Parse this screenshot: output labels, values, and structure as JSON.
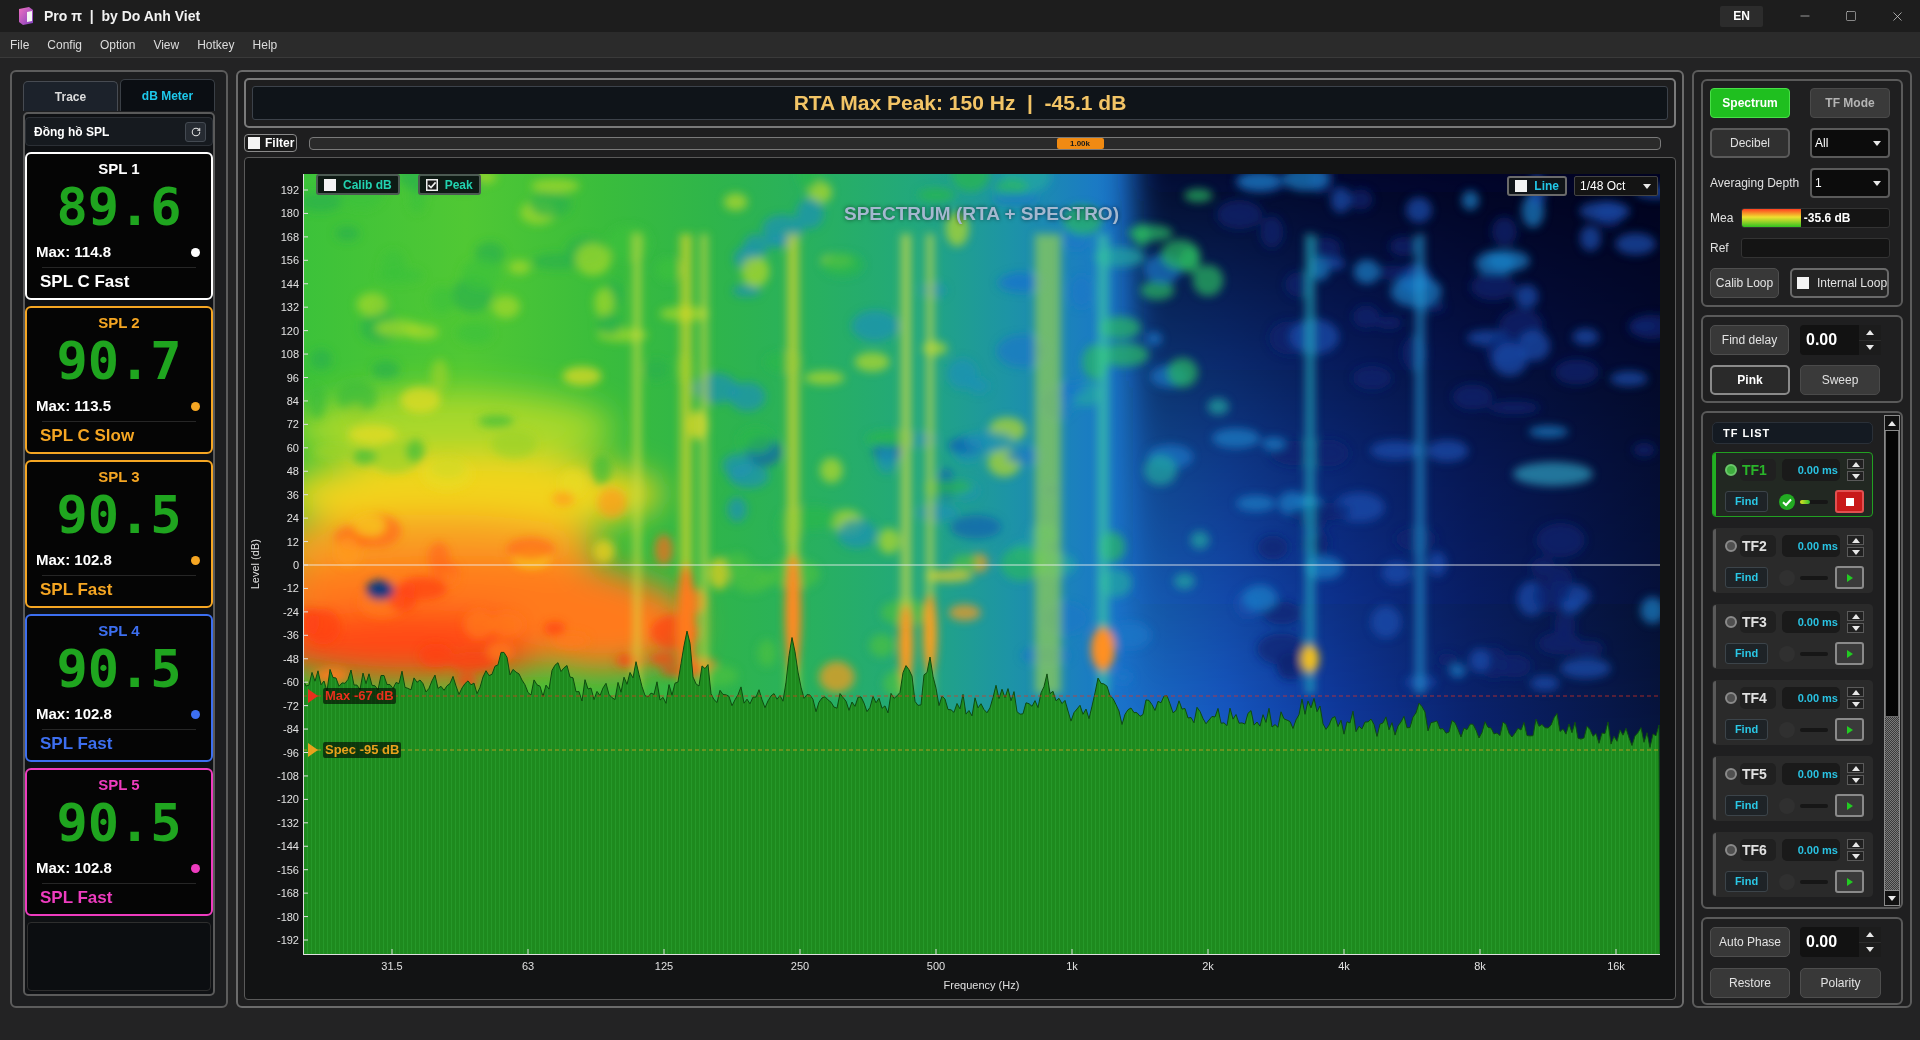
{
  "window": {
    "title": "Pro π  |  by Do Anh Viet",
    "language": "EN"
  },
  "menu": [
    "File",
    "Config",
    "Option",
    "View",
    "Hotkey",
    "Help"
  ],
  "left_panel": {
    "tabs": [
      {
        "label": "Trace",
        "selected": false
      },
      {
        "label": "dB Meter",
        "selected": true
      }
    ],
    "title": "Đồng hồ SPL",
    "meters": [
      {
        "name": "SPL 1",
        "value": "89.6",
        "max": "Max: 114.8",
        "mode": "SPL C Fast",
        "color": "#ffffff"
      },
      {
        "name": "SPL 2",
        "value": "90.7",
        "max": "Max: 113.5",
        "mode": "SPL C Slow",
        "color": "#f5a623"
      },
      {
        "name": "SPL 3",
        "value": "90.5",
        "max": "Max: 102.8",
        "mode": "SPL Fast",
        "color": "#f5a623"
      },
      {
        "name": "SPL 4",
        "value": "90.5",
        "max": "Max: 102.8",
        "mode": "SPL Fast",
        "color": "#3d6ff0"
      },
      {
        "name": "SPL 5",
        "value": "90.5",
        "max": "Max: 102.8",
        "mode": "SPL Fast",
        "color": "#ee3cbf"
      }
    ]
  },
  "readout": "RTA Max Peak: 150 Hz  |  -45.1 dB",
  "filter": {
    "label": "Filter",
    "checked": false,
    "thumb_label": "1.00k",
    "level": 0.57
  },
  "chart": {
    "title": "SPECTRUM (RTA + SPECTRO)",
    "ylabel": "Level (dB)",
    "xlabel": "Frequency (Hz)",
    "yticks": [
      "192",
      "180",
      "168",
      "156",
      "144",
      "132",
      "120",
      "108",
      "96",
      "84",
      "72",
      "60",
      "48",
      "36",
      "24",
      "12",
      "0",
      "-12",
      "-24",
      "-36",
      "-48",
      "-60",
      "-72",
      "-84",
      "-96",
      "-108",
      "-120",
      "-132",
      "-144",
      "-156",
      "-168",
      "-180",
      "-192"
    ],
    "xticks": [
      "31.5",
      "63",
      "125",
      "250",
      "500",
      "1k",
      "2k",
      "4k",
      "8k",
      "16k"
    ],
    "toggles": [
      {
        "label": "Calib dB",
        "checked": false
      },
      {
        "label": "Peak",
        "checked": true
      }
    ],
    "line_toggle": {
      "label": "Line",
      "checked": false
    },
    "resolution": "1/48 Oct",
    "markers": [
      {
        "kind": "max",
        "label": "Max -67 dB",
        "color": "#e8301c"
      },
      {
        "kind": "spec",
        "label": "Spec -95 dB",
        "color": "#e8a21c"
      }
    ]
  },
  "right_panel": {
    "modes": [
      {
        "label": "Spectrum",
        "selected": true
      },
      {
        "label": "TF Mode",
        "selected": false
      }
    ],
    "unit": "Decibel",
    "channel": "All",
    "averaging": {
      "label": "Averaging Depth",
      "value": "1"
    },
    "meters": [
      {
        "label": "Mea",
        "level": 0.4,
        "reading": "-35.6 dB"
      },
      {
        "label": "Ref"
      }
    ],
    "calib_loop": "Calib Loop",
    "internal_loop": {
      "label": "Internal Loop",
      "checked": false
    },
    "find_delay": "Find delay",
    "delay_value": "0.00",
    "signals": [
      {
        "label": "Pink",
        "selected": true
      },
      {
        "label": "Sweep",
        "selected": false
      }
    ],
    "tf_list": {
      "title": "TF LIST",
      "items": [
        {
          "name": "TF1",
          "delay": "0.00 ms",
          "find": "Find",
          "active": true,
          "level": 0.35
        },
        {
          "name": "TF2",
          "delay": "0.00 ms",
          "find": "Find",
          "active": false
        },
        {
          "name": "TF3",
          "delay": "0.00 ms",
          "find": "Find",
          "active": false
        },
        {
          "name": "TF4",
          "delay": "0.00 ms",
          "find": "Find",
          "active": false
        },
        {
          "name": "TF5",
          "delay": "0.00 ms",
          "find": "Find",
          "active": false
        },
        {
          "name": "TF6",
          "delay": "0.00 ms",
          "find": "Find",
          "active": false
        }
      ]
    },
    "auto_phase": "Auto Phase",
    "phase_value": "0.00",
    "restore": "Restore",
    "polarity": "Polarity"
  }
}
